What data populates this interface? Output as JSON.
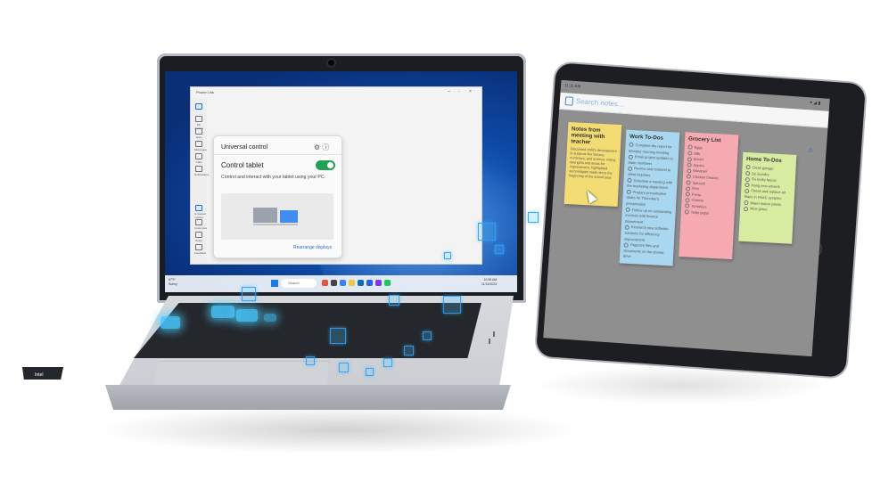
{
  "laptop": {
    "window_title": "Phone Link",
    "nav_items": [
      "",
      "My devices",
      "Apps",
      "Messages",
      "Calls",
      "Notifications",
      "",
      "Universal control",
      "Customize",
      "Setup",
      "Feedback"
    ],
    "card": {
      "title": "Universal control",
      "toggle_label": "Control tablet",
      "toggle_state": true,
      "description": "Control and interact with your tablet using your PC.",
      "link": "Rearrange displays"
    },
    "taskbar": {
      "weather_temp": "67°F",
      "weather_desc": "Sunny",
      "search_placeholder": "Search",
      "time": "10:55 AM",
      "date": "11/15/2024"
    },
    "badge": "Intel"
  },
  "tablet": {
    "status_time": "11:11 AM",
    "search_placeholder": "Search notes...",
    "notes": [
      {
        "title": "Notes from meeting with teacher",
        "color": "#f4dc74",
        "lines": [
          "Discussed child's development in subjects like literacy, numeracy, and science, noting strengths and areas for improvement, highlighted technologies made since the beginning of the school year."
        ]
      },
      {
        "title": "Work To-Dos",
        "color": "#a9d7ef",
        "items": [
          "Complete the report for Monday morning meeting",
          "Email project updates to team members",
          "Review and respond to client inquiries",
          "Schedule a meeting with the marketing department",
          "Prepare presentation slides for Thursday's presentation",
          "Follow up on outstanding invoices with finance department",
          "Research new software solutions for efficiency improvement",
          "Organize files and documents on the shared drive"
        ]
      },
      {
        "title": "Grocery List",
        "color": "#f5a9b0",
        "items": [
          "Eggs",
          "Milk",
          "Bread",
          "Apples",
          "Bananas",
          "Chicken breasts",
          "Spinach",
          "Rice",
          "Pasta",
          "Cheese",
          "Tomatoes",
          "Toilet paper"
        ]
      },
      {
        "title": "Home To-Dos",
        "color": "#d7eca0",
        "items": [
          "Clean garage",
          "Do laundry",
          "Fix leaky faucet",
          "Hang new artwork",
          "Check and replace air filters in HVAC systems",
          "Water indoor plants",
          "Mow grass"
        ]
      }
    ]
  }
}
